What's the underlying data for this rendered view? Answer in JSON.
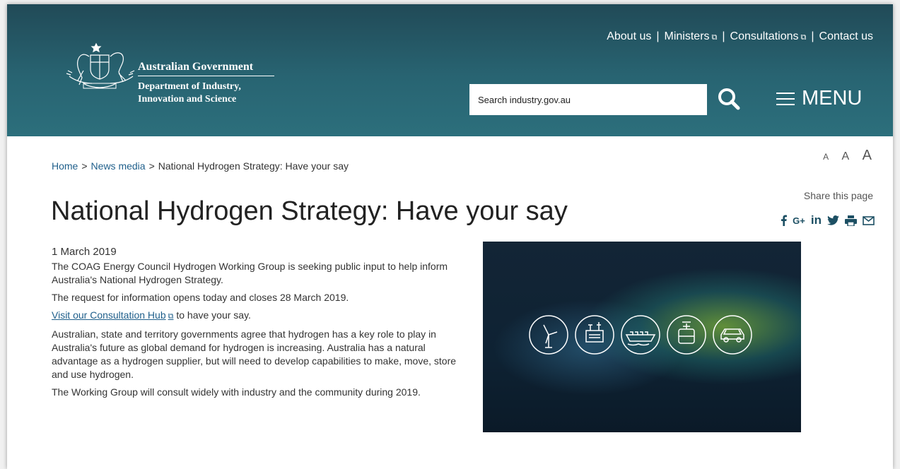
{
  "header": {
    "gov_name": "Australian Government",
    "dept_name": "Department of Industry,\nInnovation and Science",
    "nav": [
      {
        "label": "About us",
        "external": false
      },
      {
        "label": "Ministers",
        "external": true
      },
      {
        "label": "Consultations",
        "external": true
      },
      {
        "label": "Contact us",
        "external": false
      }
    ],
    "search_placeholder": "Search industry.gov.au",
    "menu_label": "MENU"
  },
  "text_size": [
    "A",
    "A",
    "A"
  ],
  "breadcrumb": [
    "Home",
    "News media",
    "National Hydrogen Strategy: Have your say"
  ],
  "breadcrumb_separator": ">",
  "share": {
    "label": "Share this page",
    "icons": [
      "facebook-icon",
      "google-plus-icon",
      "linkedin-icon",
      "twitter-icon",
      "print-icon",
      "email-icon"
    ]
  },
  "page_title": "National Hydrogen Strategy: Have your say",
  "article": {
    "date": "1 March 2019",
    "p1": "The COAG Energy Council Hydrogen Working Group is seeking public input to help inform Australia's National Hydrogen Strategy.",
    "p2": "The request for information opens today and closes 28 March 2019.",
    "link_text": "Visit our Consultation Hub",
    "link_suffix": " to have your say.",
    "p4": "Australian, state and territory governments agree that hydrogen has a key role to play in Australia's future as global demand for hydrogen is increasing. Australia has a natural advantage as a hydrogen supplier, but will need to develop capabilities to make, move, store and use hydrogen.",
    "p5": "The Working Group will consult widely with industry and the community during 2019."
  },
  "hero_icons": [
    "wind-turbine-icon",
    "electrolyser-icon",
    "ship-icon",
    "storage-tank-icon",
    "car-icon"
  ],
  "colors": {
    "header_bg": "#286472",
    "link": "#1f5f8b",
    "share_icons": "#1c4f63"
  }
}
